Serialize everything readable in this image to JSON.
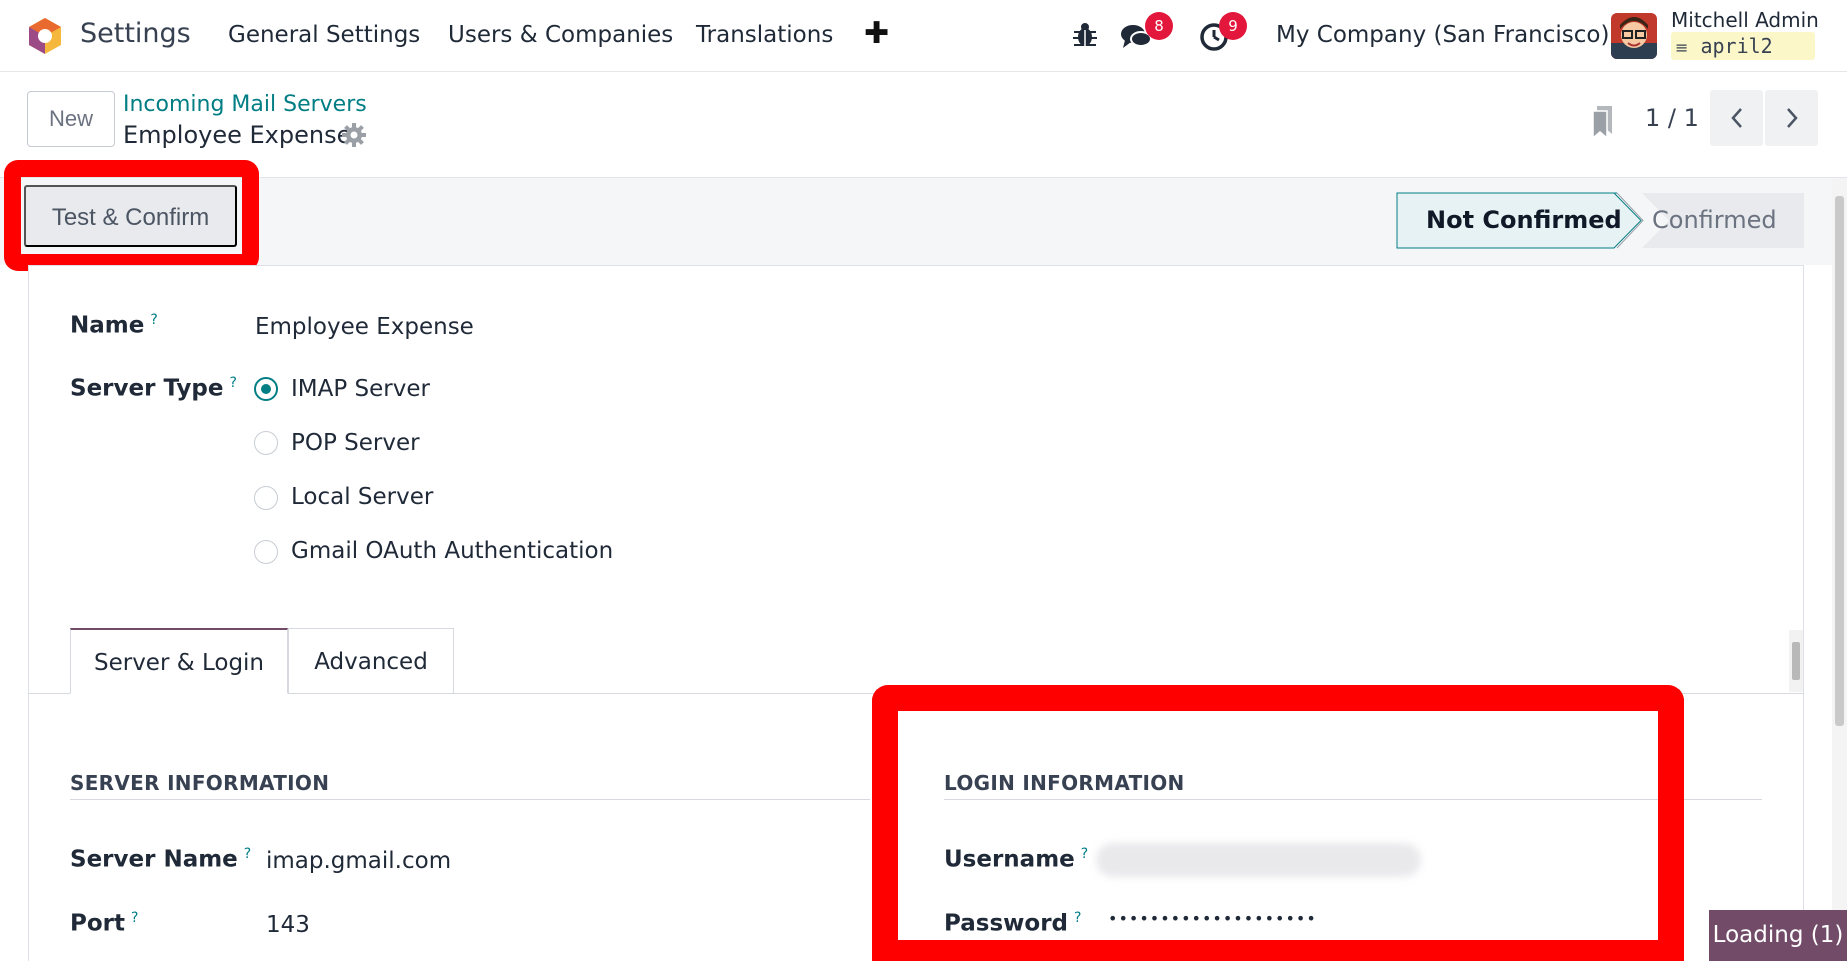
{
  "navbar": {
    "app_name": "Settings",
    "menus": [
      "General Settings",
      "Users & Companies",
      "Translations"
    ],
    "plus_label": "✚",
    "messages_count": "8",
    "activities_count": "9",
    "company": "My Company (San Francisco)",
    "user_name": "Mitchell Admin",
    "db_name": "april2"
  },
  "control_panel": {
    "new_label": "New",
    "breadcrumb_parent": "Incoming Mail Servers",
    "record_title": "Employee Expense",
    "pager": "1 / 1"
  },
  "statusbar": {
    "action_button": "Test & Confirm",
    "stages": [
      "Not Confirmed",
      "Confirmed"
    ],
    "active_stage": "Not Confirmed"
  },
  "form": {
    "name_label": "Name",
    "name_value": "Employee Expense",
    "server_type_label": "Server Type",
    "server_types": [
      "IMAP Server",
      "POP Server",
      "Local Server",
      "Gmail OAuth Authentication"
    ],
    "selected_server_type": "IMAP Server",
    "help_mark": "?",
    "tabs": [
      "Server & Login",
      "Advanced"
    ],
    "active_tab": "Server & Login",
    "server_section_title": "SERVER INFORMATION",
    "server_name_label": "Server Name",
    "server_name_value": "imap.gmail.com",
    "port_label": "Port",
    "port_value": "143",
    "login_section_title": "LOGIN INFORMATION",
    "username_label": "Username",
    "password_label": "Password",
    "password_value": "••••••••••••••••••••"
  },
  "loading_indicator": "Loading (1)",
  "colors": {
    "brand": "#714b67",
    "accent": "#017e84",
    "badge": "#e3173b",
    "annotation": "#ff0000"
  }
}
